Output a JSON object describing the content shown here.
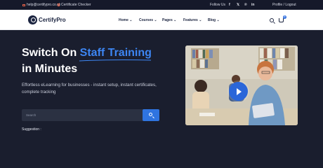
{
  "topbar": {
    "email": "help@certifypro.co.uk",
    "certificate_checker": "Certificate Checker",
    "follow_us": "Follow Us",
    "social": {
      "facebook": "f",
      "twitter": "𝕏",
      "pinterest": "℗",
      "linkedin": "in"
    },
    "profile_logout": "Profile / Logout"
  },
  "header": {
    "logo_text": "CertifyPro",
    "nav": [
      {
        "label": "Home ⌄"
      },
      {
        "label": "Courses ⌄"
      },
      {
        "label": "Pages ⌄"
      },
      {
        "label": "Features ⌄"
      },
      {
        "label": "Blog ⌄"
      }
    ],
    "cart_count": "0"
  },
  "hero": {
    "title_line1_a": "Switch On ",
    "title_line1_b": "Staff Training",
    "title_line2": "in Minutes",
    "subtitle": "Effortless eLearning for businesses - instant setup, instant certificates, complete tracking",
    "search_placeholder": "Search",
    "suggestion_label": "Suggestion :"
  },
  "colors": {
    "accent": "#3d86f3",
    "background": "#1a1e2e",
    "button": "#2f74e0"
  },
  "icons": [
    "mail-icon",
    "certificate-icon",
    "facebook-icon",
    "twitter-icon",
    "pinterest-icon",
    "linkedin-icon",
    "search-icon",
    "cart-icon",
    "play-icon"
  ]
}
